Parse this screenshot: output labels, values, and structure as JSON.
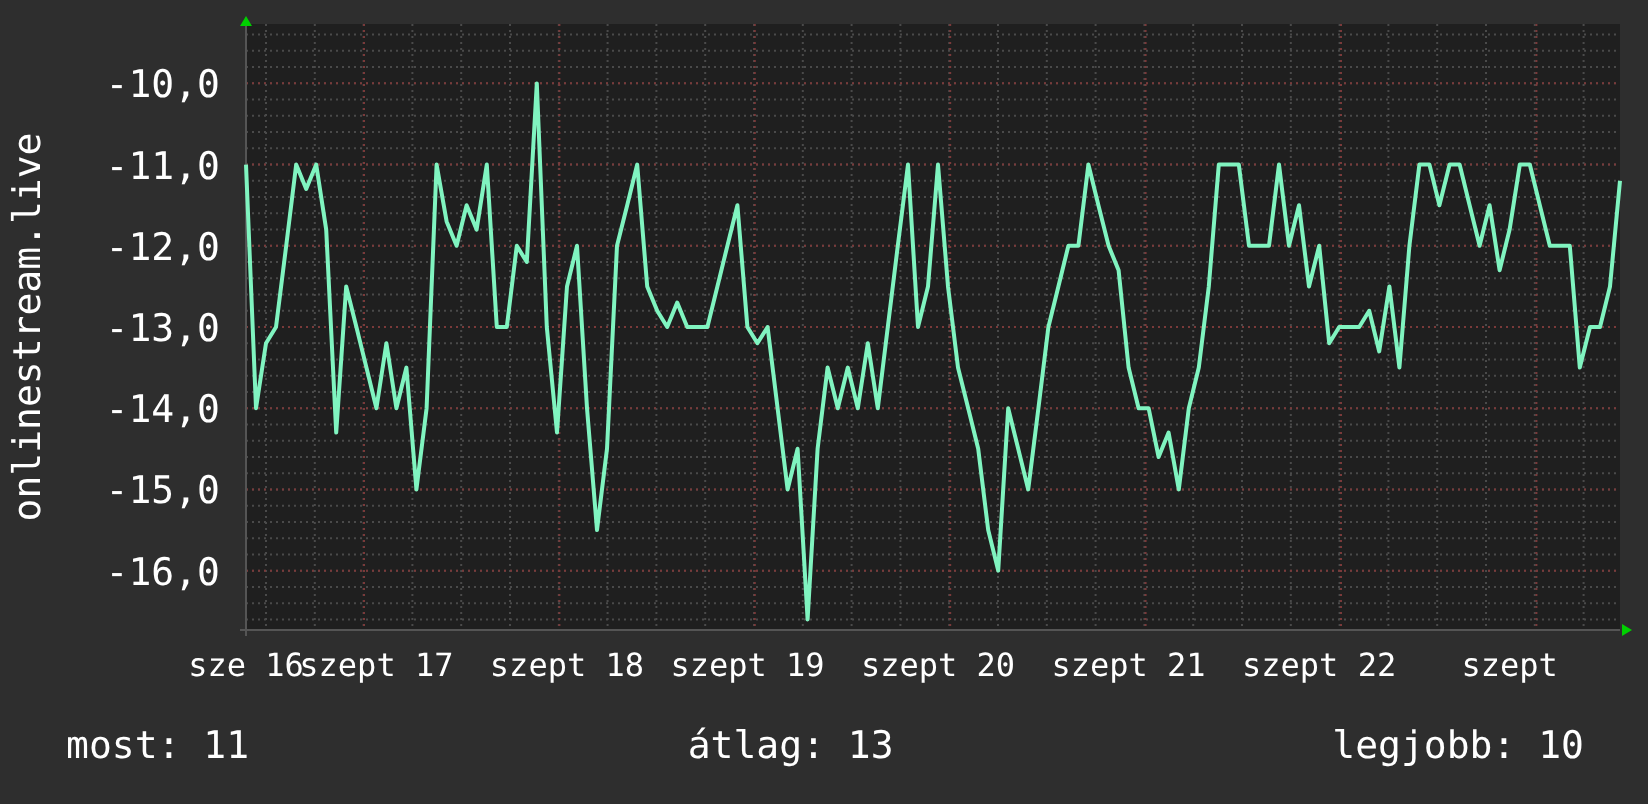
{
  "chart": {
    "chart_data": {
      "type": "line",
      "ylabel": "onlinestream.live",
      "grid": true,
      "ylim": [
        -16.73,
        -9.27
      ],
      "categories": [
        "sze 16",
        null,
        null,
        null,
        null,
        null,
        null,
        null,
        null,
        null,
        null,
        null,
        null,
        "szept 17",
        null,
        null,
        null,
        null,
        null,
        null,
        null,
        null,
        null,
        null,
        null,
        null,
        null,
        null,
        null,
        null,
        null,
        null,
        "szept 18",
        null,
        null,
        null,
        null,
        null,
        null,
        null,
        null,
        null,
        null,
        null,
        null,
        null,
        null,
        null,
        null,
        null,
        "szept 19",
        null,
        null,
        null,
        null,
        null,
        null,
        null,
        null,
        null,
        null,
        null,
        null,
        null,
        null,
        null,
        null,
        null,
        null,
        "szept 20",
        null,
        null,
        null,
        null,
        null,
        null,
        null,
        null,
        null,
        null,
        null,
        null,
        null,
        null,
        null,
        null,
        null,
        null,
        "szept 21",
        null,
        null,
        null,
        null,
        null,
        null,
        null,
        null,
        null,
        null,
        null,
        null,
        null,
        null,
        null,
        null,
        null,
        null,
        "szept 22",
        null,
        null,
        null,
        null,
        null,
        null,
        null,
        null,
        null,
        null,
        null,
        null,
        null,
        null,
        null,
        null,
        null,
        null,
        "szept",
        null,
        null,
        null,
        null,
        null,
        null,
        null,
        null,
        null,
        null,
        null
      ],
      "yticks": [
        {
          "value": -10,
          "label": "-10,0"
        },
        {
          "value": -11,
          "label": "-11,0"
        },
        {
          "value": -12,
          "label": "-12,0"
        },
        {
          "value": -13,
          "label": "-13,0"
        },
        {
          "value": -14,
          "label": "-14,0"
        },
        {
          "value": -15,
          "label": "-15,0"
        },
        {
          "value": -16,
          "label": "-16,0"
        }
      ],
      "series": [
        {
          "color": "#80f4c0",
          "values": [
            -11,
            -14,
            -13.2,
            -13,
            -12,
            -11,
            -11.3,
            -11,
            -11.8,
            -14.3,
            -12.5,
            -13,
            -13.5,
            -14,
            -13.2,
            -14,
            -13.5,
            -15,
            -14,
            -11,
            -11.7,
            -12,
            -11.5,
            -11.8,
            -11,
            -13,
            -13,
            -12,
            -12.2,
            -10,
            -13,
            -14.3,
            -12.5,
            -12,
            -14,
            -15.5,
            -14.5,
            -12,
            -11.5,
            -11,
            -12.5,
            -12.8,
            -13,
            -12.7,
            -13,
            -13,
            -13,
            -12.5,
            -12,
            -11.5,
            -13,
            -13.2,
            -13,
            -14,
            -15,
            -14.5,
            -16.6,
            -14.5,
            -13.5,
            -14,
            -13.5,
            -14,
            -13.2,
            -14,
            -13,
            -12,
            -11,
            -13,
            -12.5,
            -11,
            -12.5,
            -13.5,
            -14,
            -14.5,
            -15.5,
            -16,
            -14,
            -14.5,
            -15,
            -14,
            -13,
            -12.5,
            -12,
            -12,
            -11,
            -11.5,
            -12,
            -12.3,
            -13.5,
            -14,
            -14,
            -14.6,
            -14.3,
            -15,
            -14,
            -13.5,
            -12.5,
            -11,
            -11,
            -11,
            -12,
            -12,
            -12,
            -11,
            -12,
            -11.5,
            -12.5,
            -12,
            -13.2,
            -13,
            -13,
            -13,
            -12.8,
            -13.3,
            -12.5,
            -13.5,
            -12,
            -11,
            -11,
            -11.5,
            -11,
            -11,
            -11.5,
            -12,
            -11.5,
            -12.3,
            -11.8,
            -11,
            -11,
            -11.5,
            -12,
            -12,
            -12,
            -13.5,
            -13,
            -13,
            -12.5,
            -11.2
          ]
        }
      ]
    }
  },
  "summary": [
    {
      "label": "most: 11"
    },
    {
      "label": "átlag: 13"
    },
    {
      "label": "legjobb: 10"
    }
  ]
}
